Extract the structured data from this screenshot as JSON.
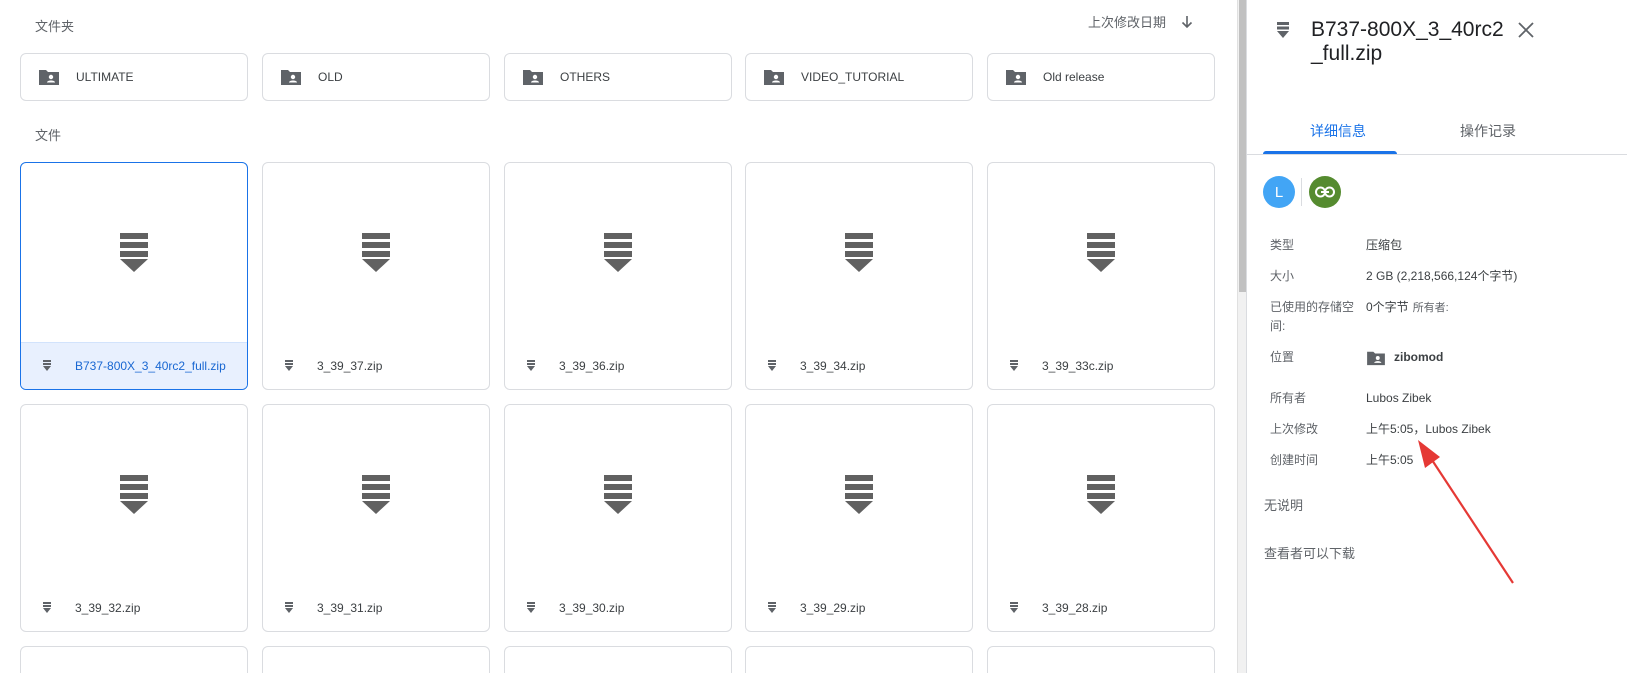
{
  "main": {
    "folders_label": "文件夹",
    "files_label": "文件",
    "sort": {
      "label": "上次修改日期",
      "direction_icon": "arrow-down-icon"
    },
    "folders": [
      {
        "name": "ULTIMATE"
      },
      {
        "name": "OLD"
      },
      {
        "name": "OTHERS"
      },
      {
        "name": "VIDEO_TUTORIAL"
      },
      {
        "name": "Old release"
      }
    ],
    "files": [
      {
        "name": "B737-800X_3_40rc2_full.zip",
        "selected": true
      },
      {
        "name": "3_39_37.zip"
      },
      {
        "name": "3_39_36.zip"
      },
      {
        "name": "3_39_34.zip"
      },
      {
        "name": "3_39_33c.zip"
      },
      {
        "name": "3_39_32.zip"
      },
      {
        "name": "3_39_31.zip"
      },
      {
        "name": "3_39_30.zip"
      },
      {
        "name": "3_39_29.zip"
      },
      {
        "name": "3_39_28.zip"
      }
    ]
  },
  "panel": {
    "title": "B737-800X_3_40rc2_full.zip",
    "tabs": [
      "详细信息",
      "操作记录"
    ],
    "avatar_letter": "L",
    "props": {
      "type_label": "类型",
      "type_value": "压缩包",
      "size_label": "大小",
      "size_value": "2 GB (2,218,566,124个字节)",
      "storage_label": "已使用的存储空间:",
      "storage_value": "0个字节",
      "storage_owners": "所有者:",
      "location_label": "位置",
      "location_value": "zibomod",
      "owner_label": "所有者",
      "owner_value": "Lubos Zibek",
      "modified_label": "上次修改",
      "modified_value": "上午5:05，Lubos Zibek",
      "created_label": "创建时间",
      "created_value": "上午5:05"
    },
    "description": "无说明",
    "download_note": "查看者可以下载"
  },
  "colors": {
    "accent": "#1a73e8",
    "annotation_arrow": "#e53935",
    "link_avatar": "#558b2f",
    "user_avatar": "#42a5f5"
  }
}
